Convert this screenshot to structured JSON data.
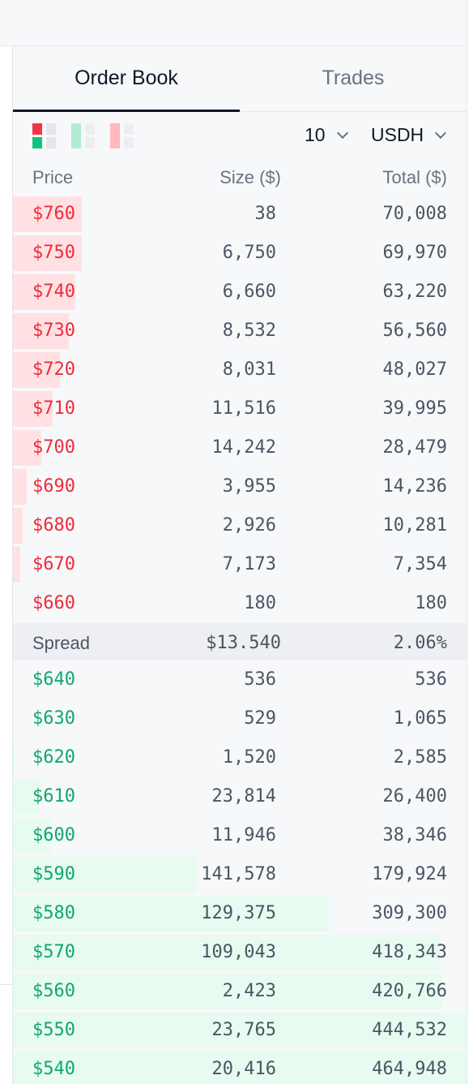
{
  "tabs": [
    {
      "label": "Order Book",
      "active": true
    },
    {
      "label": "Trades",
      "active": false
    }
  ],
  "controls": {
    "depth": "10",
    "currency": "USDH",
    "view_icons": [
      "both-sides-view-icon",
      "bids-only-view-icon",
      "asks-only-view-icon"
    ]
  },
  "columns": {
    "price": "Price",
    "size": "Size ($)",
    "total": "Total ($)"
  },
  "asks": [
    {
      "price": "$760",
      "size": "38",
      "total": "70,008"
    },
    {
      "price": "$750",
      "size": "6,750",
      "total": "69,970"
    },
    {
      "price": "$740",
      "size": "6,660",
      "total": "63,220"
    },
    {
      "price": "$730",
      "size": "8,532",
      "total": "56,560"
    },
    {
      "price": "$720",
      "size": "8,031",
      "total": "48,027"
    },
    {
      "price": "$710",
      "size": "11,516",
      "total": "39,995"
    },
    {
      "price": "$700",
      "size": "14,242",
      "total": "28,479"
    },
    {
      "price": "$690",
      "size": "3,955",
      "total": "14,236"
    },
    {
      "price": "$680",
      "size": "2,926",
      "total": "10,281"
    },
    {
      "price": "$670",
      "size": "7,173",
      "total": "7,354"
    },
    {
      "price": "$660",
      "size": "180",
      "total": "180"
    }
  ],
  "spread": {
    "label": "Spread",
    "value": "$13.540",
    "percent": "2.06%"
  },
  "bids": [
    {
      "price": "$640",
      "size": "536",
      "total": "536"
    },
    {
      "price": "$630",
      "size": "529",
      "total": "1,065"
    },
    {
      "price": "$620",
      "size": "1,520",
      "total": "2,585"
    },
    {
      "price": "$610",
      "size": "23,814",
      "total": "26,400"
    },
    {
      "price": "$600",
      "size": "11,946",
      "total": "38,346"
    },
    {
      "price": "$590",
      "size": "141,578",
      "total": "179,924"
    },
    {
      "price": "$580",
      "size": "129,375",
      "total": "309,300"
    },
    {
      "price": "$570",
      "size": "109,043",
      "total": "418,343"
    },
    {
      "price": "$560",
      "size": "2,423",
      "total": "420,766"
    },
    {
      "price": "$550",
      "size": "23,765",
      "total": "444,532"
    },
    {
      "price": "$540",
      "size": "20,416",
      "total": "464,948"
    }
  ],
  "colors": {
    "ask": "#ef2b3a",
    "bid": "#10a86a",
    "ask_bar": "#ffe1e4",
    "bid_bar": "#e8fbf1"
  }
}
